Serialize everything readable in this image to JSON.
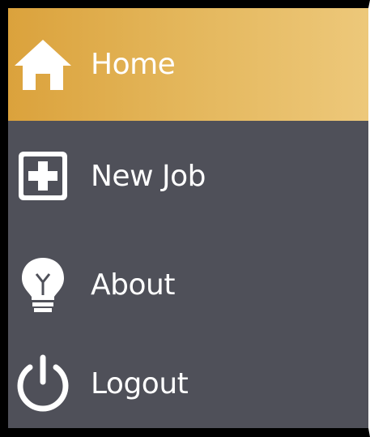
{
  "menu": {
    "items": [
      {
        "label": "Home",
        "icon": "home-icon",
        "active": true
      },
      {
        "label": "New Job",
        "icon": "plus-box-icon",
        "active": false
      },
      {
        "label": "About",
        "icon": "lightbulb-icon",
        "active": false
      },
      {
        "label": "Logout",
        "icon": "power-icon",
        "active": false
      }
    ]
  },
  "colors": {
    "active_start": "#dba23c",
    "active_end": "#edc87a",
    "background": "#4f5059",
    "text": "#ffffff",
    "frame": "#000000"
  }
}
